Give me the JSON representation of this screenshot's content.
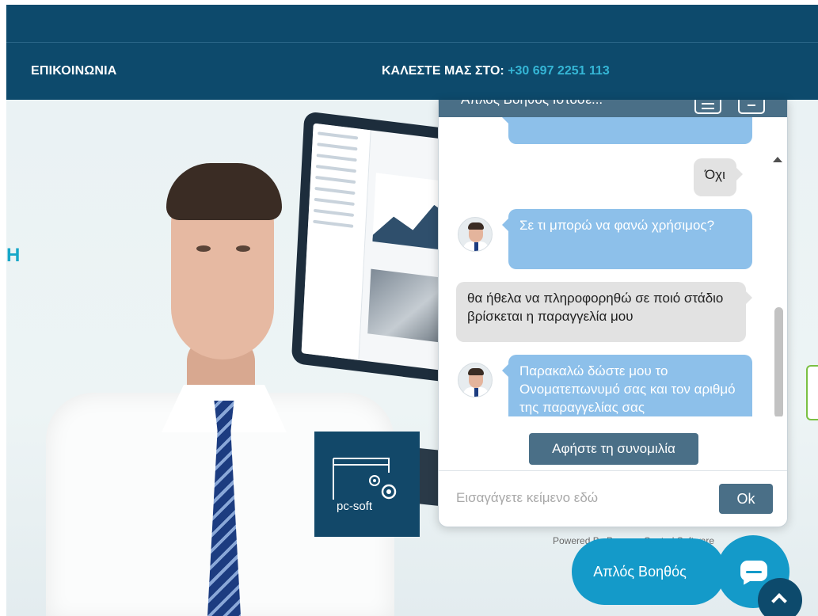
{
  "header": {
    "nav_contact": "ΕΠΙΚΟΙΝΩΝΙΑ",
    "call_label": "ΚΑΛΕΣΤΕ ΜΑΣ ΣΤΟ:",
    "phone": "+30 697 2251 113"
  },
  "hero": {
    "heading_fragment": "Η",
    "logo_text": "pc-soft",
    "powered_by": "Powered By Process Control Software"
  },
  "chat": {
    "title": "Απλός Βοηθός Ιστοσε...",
    "messages": [
      {
        "from": "user",
        "text": "Όχι"
      },
      {
        "from": "bot",
        "text": "Σε τι μπορώ να φανώ χρήσιμος?"
      },
      {
        "from": "user",
        "text": "θα ήθελα να πληροφορηθώ σε ποιό στάδιο βρίσκεται η παραγγελία μου"
      },
      {
        "from": "bot",
        "text": "Παρακαλώ δώστε μου το Ονοματεπωνυμό σας και τον αριθμό της παραγγελίας σας"
      }
    ],
    "leave_button": "Αφήστε τη συνομιλία",
    "input_placeholder": "Εισαγάγετε κείμενο εδώ",
    "ok_button": "Ok"
  },
  "launcher": {
    "label": "Απλός Βοηθός"
  },
  "icons": {
    "chat": "chat-bubble-icon",
    "scroll_top": "chevron-up-icon",
    "header_menu": "menu-icon",
    "header_window": "window-icon"
  },
  "colors": {
    "header_bg": "#0d4a6c",
    "accent_phone": "#35b6d6",
    "chat_header": "#4a6f87",
    "bot_bubble": "#8dc0ea",
    "user_bubble": "#e2e2e2",
    "launcher": "#149ac9"
  }
}
